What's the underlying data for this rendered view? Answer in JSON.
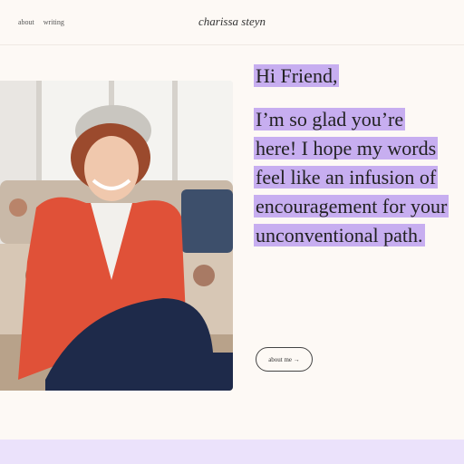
{
  "header": {
    "nav": [
      "about",
      "writing"
    ],
    "brand": "charissa steyn"
  },
  "hero": {
    "greeting": "Hi Friend,",
    "message": "I’m so glad you’re here! I hope my words feel like an infusion of encouragement for your unconventional path.",
    "about_button": "about me →"
  },
  "colors": {
    "background": "#fdf9f5",
    "highlight": "#c7aef0",
    "footer_band": "#ebe2fb"
  }
}
